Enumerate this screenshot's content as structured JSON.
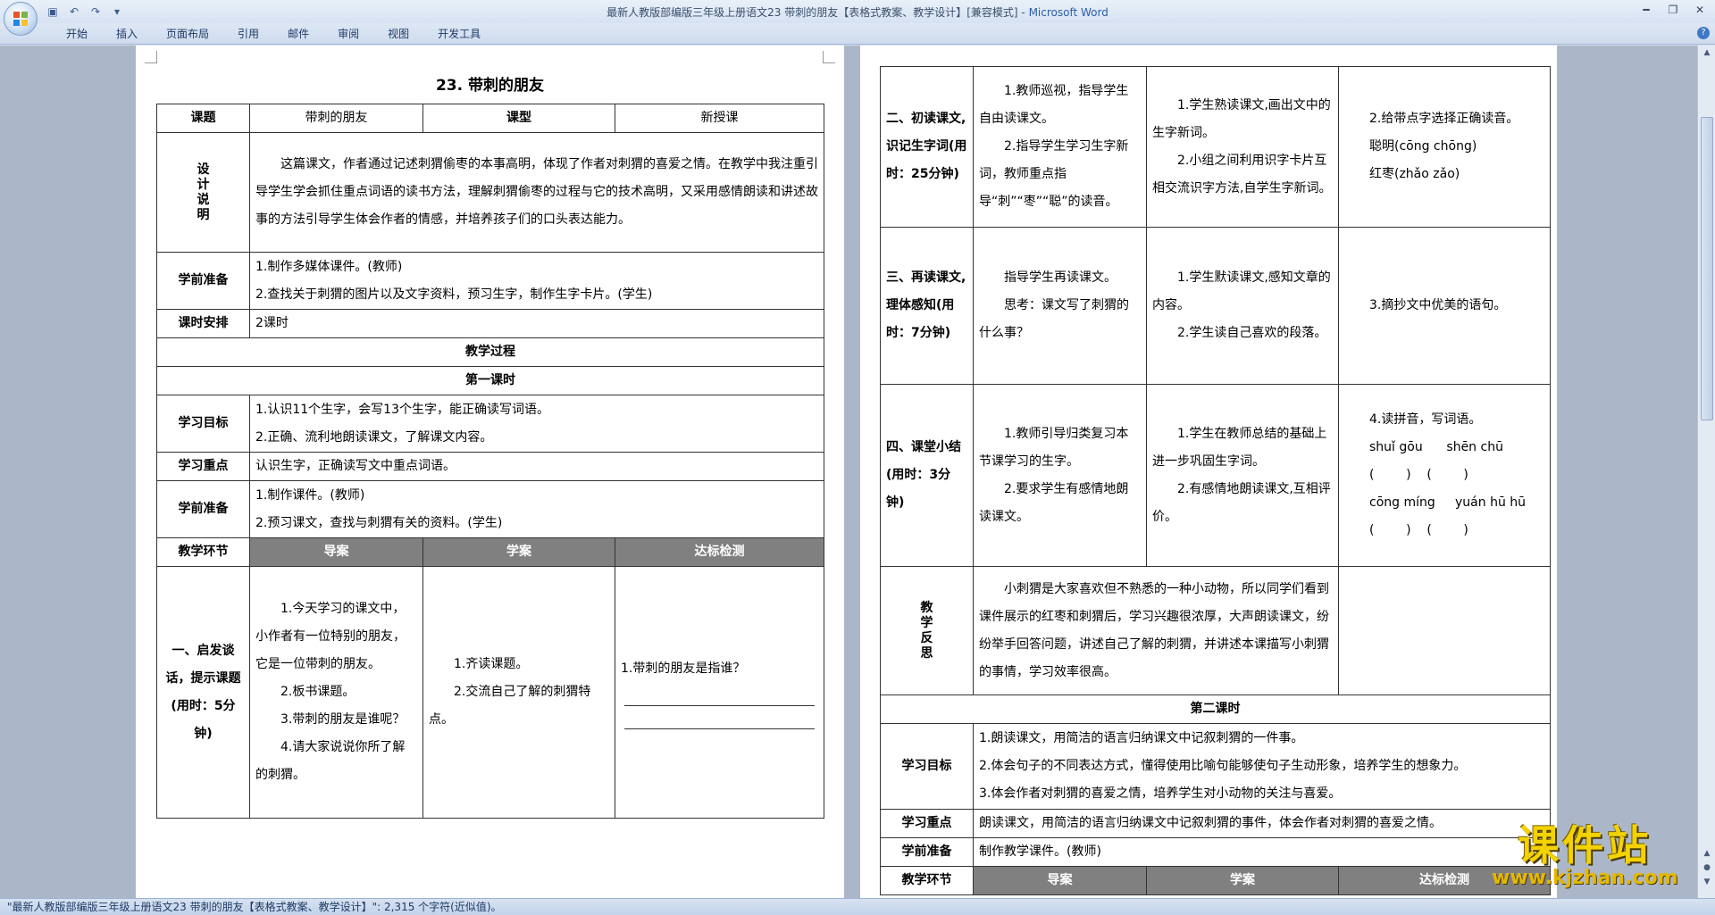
{
  "window": {
    "title_doc": "最新人教版部编版三年级上册语文23 带刺的朋友【表格式教案、教学设计】[兼容模式] - ",
    "title_app": "Microsoft Word"
  },
  "ribbon": {
    "tabs": [
      "开始",
      "插入",
      "页面布局",
      "引用",
      "邮件",
      "审阅",
      "视图",
      "开发工具"
    ]
  },
  "left_page": {
    "title": "23. 带刺的朋友",
    "row_course": {
      "label": "课题",
      "value": "带刺的朋友",
      "type_label": "课型",
      "type_value": "新授课"
    },
    "design": {
      "label": "设计说明",
      "text": "这篇课文，作者通过记述刺猬偷枣的本事高明，体现了作者对刺猬的喜爱之情。在教学中我注重引导学生学会抓住重点词语的读书方法，理解刺猬偷枣的过程与它的技术高明，又采用感情朗读和讲述故事的方法引导学生体会作者的情感，并培养孩子们的口头表达能力。"
    },
    "prep": {
      "label": "学前准备",
      "items": [
        "1.制作多媒体课件。(教师)",
        "2.查找关于刺猬的图片以及文字资料，预习生字，制作生字卡片。(学生)"
      ]
    },
    "hours": {
      "label": "课时安排",
      "value": "2课时"
    },
    "process": "教学过程",
    "lesson1": "第一课时",
    "goals": {
      "label": "学习目标",
      "items": [
        "1.认识11个生字，会写13个生字，能正确读写词语。",
        "2.正确、流利地朗读课文，了解课文内容。"
      ]
    },
    "focus": {
      "label": "学习重点",
      "value": "认识生字，正确读写文中重点词语。"
    },
    "prep2": {
      "label": "学前准备",
      "items": [
        "1.制作课件。(教师)",
        "2.预习课文，查找与刺猬有关的资料。(学生)"
      ]
    },
    "header": {
      "label": "教学环节",
      "c1": "导案",
      "c2": "学案",
      "c3": "达标检测"
    },
    "step1": {
      "label": "一、启发谈话，提示课题(用时：5分钟)",
      "guide": [
        "1.今天学习的课文中，小作者有一位特别的朋友，它是一位带刺的朋友。",
        "2.板书课题。",
        "3.带刺的朋友是谁呢？",
        "4.请大家说说你所了解的刺猬。"
      ],
      "study": [
        "1.齐读课题。",
        "2.交流自己了解的刺猬特点。"
      ],
      "check": "1.带刺的朋友是指谁？"
    }
  },
  "right_page": {
    "step2": {
      "label": "二、初读课文,识记生字词(用时：25分钟)",
      "guide": [
        "1.教师巡视，指导学生自由读课文。",
        "2.指导学生学习生字新词，教师重点指导“刺”“枣”“聪”的读音。"
      ],
      "study": [
        "1.学生熟读课文,画出文中的生字新词。",
        "2.小组之间利用识字卡片互相交流识字方法,自学生字新词。"
      ],
      "check": [
        "2.给带点字选择正确读音。",
        "聪明(cōng chōng)",
        "红枣(zhǎo zǎo)"
      ]
    },
    "step3": {
      "label": "三、再读课文,理体感知(用时：7分钟)",
      "guide": [
        "指导学生再读课文。",
        "思考：课文写了刺猬的什么事？"
      ],
      "study": [
        "1.学生默读课文,感知文章的内容。",
        "2.学生读自己喜欢的段落。"
      ],
      "check": "3.摘抄文中优美的语句。"
    },
    "step4": {
      "label": "四、课堂小结(用时：3分钟)",
      "guide": [
        "1.教师引导归类复习本节课学习的生字。",
        "2.要求学生有感情地朗读课文。"
      ],
      "study": [
        "1.学生在教师总结的基础上进一步巩固生字词。",
        "2.有感情地朗读课文,互相评价。"
      ],
      "check": [
        "4.读拼音，写词语。",
        "shuǐ gōu      shēn chū",
        "(        )    (        )",
        "cōng míng     yuán hū hū",
        "(        )    (        )"
      ]
    },
    "reflect": {
      "label": "教学反思",
      "text": "小刺猬是大家喜欢但不熟悉的一种小动物，所以同学们看到课件展示的红枣和刺猬后，学习兴趣很浓厚，大声朗读课文，纷纷举手回答问题，讲述自己了解的刺猬，并讲述本课描写小刺猬的事情，学习效率很高。"
    },
    "lesson2": "第二课时",
    "goals2": {
      "label": "学习目标",
      "items": [
        "1.朗读课文，用简洁的语言归纳课文中记叙刺猬的一件事。",
        "2.体会句子的不同表达方式，懂得使用比喻句能够使句子生动形象，培养学生的想象力。",
        "3.体会作者对刺猬的喜爱之情，培养学生对小动物的关注与喜爱。"
      ]
    },
    "focus2": {
      "label": "学习重点",
      "value": "朗读课文，用简洁的语言归纳课文中记叙刺猬的事件，体会作者对刺猬的喜爱之情。"
    },
    "prep3": {
      "label": "学前准备",
      "value": "制作教学课件。(教师)"
    },
    "header2": {
      "label": "教学环节",
      "c1": "导案",
      "c2": "学案",
      "c3": "达标检测"
    }
  },
  "status": "\"最新人教版部编版三年级上册语文23 带刺的朋友【表格式教案、教学设计】\": 2,315 个字符(近似值)。",
  "watermark": {
    "big": "课件站",
    "small": "www.kjzhan.com"
  }
}
